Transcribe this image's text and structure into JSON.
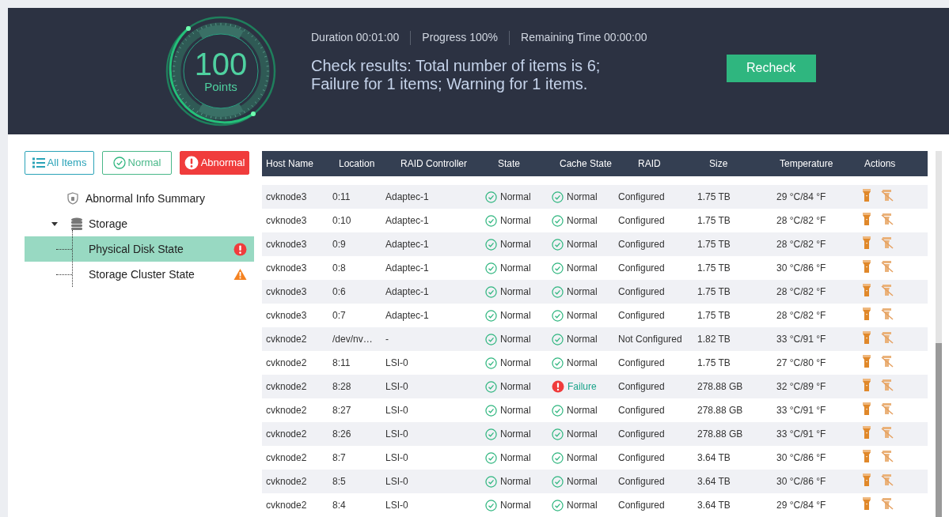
{
  "score": {
    "value": "100",
    "unit": "Points"
  },
  "stats": [
    "Duration 00:01:00",
    "Progress 100%",
    "Remaining Time 00:00:00"
  ],
  "result": {
    "line_1": "Check results: Total number of items is 6;",
    "line_2": "Failure for 1 items; Warning for 1 items."
  },
  "recheck_button": "Recheck",
  "filters": [
    {
      "kind": "all",
      "label": "All Items",
      "selected": false
    },
    {
      "kind": "normal",
      "label": "Normal",
      "selected": false
    },
    {
      "kind": "abnormal",
      "label": "Abnormal",
      "selected": true
    }
  ],
  "tree": [
    {
      "kind": "summary",
      "label": "Abnormal Info Summary",
      "selected": false
    },
    {
      "kind": "group",
      "label": "Storage",
      "expanded": true,
      "selected": false,
      "children": [
        {
          "label": "Physical Disk State",
          "kind": "failure",
          "selected": true
        },
        {
          "label": "Storage Cluster State",
          "kind": "warning",
          "selected": false
        }
      ]
    }
  ],
  "table": {
    "columns": [
      "Host Name",
      "Location",
      "RAID Controller",
      "State",
      "Cache State",
      "RAID",
      "Size",
      "Temperature",
      "Actions"
    ],
    "rows": [
      {
        "host": "cvknode3",
        "location": "0:11",
        "controller": "Adaptec-1",
        "state": {
          "kind": "normal",
          "text": "Normal"
        },
        "cache": {
          "kind": "normal",
          "text": "Normal"
        },
        "raid": "Configured",
        "size": "1.75 TB",
        "temperature": "29 °C/84 °F"
      },
      {
        "host": "cvknode3",
        "location": "0:10",
        "controller": "Adaptec-1",
        "state": {
          "kind": "normal",
          "text": "Normal"
        },
        "cache": {
          "kind": "normal",
          "text": "Normal"
        },
        "raid": "Configured",
        "size": "1.75 TB",
        "temperature": "28 °C/82 °F"
      },
      {
        "host": "cvknode3",
        "location": "0:9",
        "controller": "Adaptec-1",
        "state": {
          "kind": "normal",
          "text": "Normal"
        },
        "cache": {
          "kind": "normal",
          "text": "Normal"
        },
        "raid": "Configured",
        "size": "1.75 TB",
        "temperature": "28 °C/82 °F"
      },
      {
        "host": "cvknode3",
        "location": "0:8",
        "controller": "Adaptec-1",
        "state": {
          "kind": "normal",
          "text": "Normal"
        },
        "cache": {
          "kind": "normal",
          "text": "Normal"
        },
        "raid": "Configured",
        "size": "1.75 TB",
        "temperature": "30 °C/86 °F"
      },
      {
        "host": "cvknode3",
        "location": "0:6",
        "controller": "Adaptec-1",
        "state": {
          "kind": "normal",
          "text": "Normal"
        },
        "cache": {
          "kind": "normal",
          "text": "Normal"
        },
        "raid": "Configured",
        "size": "1.75 TB",
        "temperature": "28 °C/82 °F"
      },
      {
        "host": "cvknode3",
        "location": "0:7",
        "controller": "Adaptec-1",
        "state": {
          "kind": "normal",
          "text": "Normal"
        },
        "cache": {
          "kind": "normal",
          "text": "Normal"
        },
        "raid": "Configured",
        "size": "1.75 TB",
        "temperature": "28 °C/82 °F"
      },
      {
        "host": "cvknode2",
        "location": "/dev/nv…",
        "controller": "-",
        "state": {
          "kind": "normal",
          "text": "Normal"
        },
        "cache": {
          "kind": "normal",
          "text": "Normal"
        },
        "raid": "Not Configured",
        "size": "1.82 TB",
        "temperature": "33 °C/91 °F"
      },
      {
        "host": "cvknode2",
        "location": "8:11",
        "controller": "LSI-0",
        "state": {
          "kind": "normal",
          "text": "Normal"
        },
        "cache": {
          "kind": "normal",
          "text": "Normal"
        },
        "raid": "Configured",
        "size": "1.75 TB",
        "temperature": "27 °C/80 °F"
      },
      {
        "host": "cvknode2",
        "location": "8:28",
        "controller": "LSI-0",
        "state": {
          "kind": "normal",
          "text": "Normal"
        },
        "cache": {
          "kind": "failure",
          "text": "Failure"
        },
        "raid": "Configured",
        "size": "278.88 GB",
        "temperature": "32 °C/89 °F"
      },
      {
        "host": "cvknode2",
        "location": "8:27",
        "controller": "LSI-0",
        "state": {
          "kind": "normal",
          "text": "Normal"
        },
        "cache": {
          "kind": "normal",
          "text": "Normal"
        },
        "raid": "Configured",
        "size": "278.88 GB",
        "temperature": "33 °C/91 °F"
      },
      {
        "host": "cvknode2",
        "location": "8:26",
        "controller": "LSI-0",
        "state": {
          "kind": "normal",
          "text": "Normal"
        },
        "cache": {
          "kind": "normal",
          "text": "Normal"
        },
        "raid": "Configured",
        "size": "278.88 GB",
        "temperature": "33 °C/91 °F"
      },
      {
        "host": "cvknode2",
        "location": "8:7",
        "controller": "LSI-0",
        "state": {
          "kind": "normal",
          "text": "Normal"
        },
        "cache": {
          "kind": "normal",
          "text": "Normal"
        },
        "raid": "Configured",
        "size": "3.64 TB",
        "temperature": "30 °C/86 °F"
      },
      {
        "host": "cvknode2",
        "location": "8:5",
        "controller": "LSI-0",
        "state": {
          "kind": "normal",
          "text": "Normal"
        },
        "cache": {
          "kind": "normal",
          "text": "Normal"
        },
        "raid": "Configured",
        "size": "3.64 TB",
        "temperature": "30 °C/86 °F"
      },
      {
        "host": "cvknode2",
        "location": "8:4",
        "controller": "LSI-0",
        "state": {
          "kind": "normal",
          "text": "Normal"
        },
        "cache": {
          "kind": "normal",
          "text": "Normal"
        },
        "raid": "Configured",
        "size": "3.64 TB",
        "temperature": "29 °C/84 °F"
      }
    ]
  }
}
